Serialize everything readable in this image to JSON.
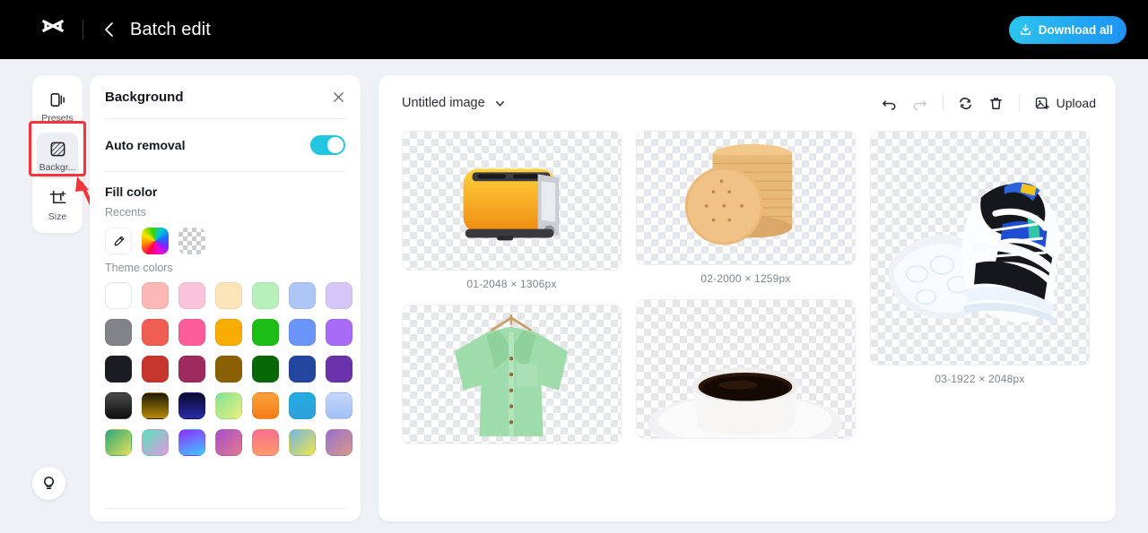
{
  "header": {
    "logo_icon": "capcut-logo-icon",
    "back_icon": "chevron-left-icon",
    "title": "Batch edit",
    "download_label": "Download all",
    "download_icon": "download-icon",
    "accent": "#22a7f0",
    "bar_bg": "#000000"
  },
  "sidebar": {
    "items": [
      {
        "label": "Presets",
        "icon": "presets-icon",
        "active": false
      },
      {
        "label": "Backgr...",
        "icon": "background-icon",
        "active": true
      },
      {
        "label": "Size",
        "icon": "crop-size-icon",
        "active": false
      }
    ],
    "tips_icon": "lightbulb-icon",
    "annotation_color": "#f4333a"
  },
  "panel": {
    "title": "Background",
    "close_icon": "close-icon",
    "auto_removal": {
      "label": "Auto removal",
      "state": "on",
      "toggle_color": "#22c6e0"
    },
    "fill_color": {
      "title": "Fill color",
      "recents_label": "Recents",
      "recents": [
        {
          "name": "eyedropper-swatch",
          "kind": "eyedropper"
        },
        {
          "name": "rainbow-picker-swatch",
          "kind": "rainbow"
        },
        {
          "name": "transparent-swatch",
          "kind": "checker"
        }
      ],
      "theme_label": "Theme colors",
      "theme_colors": [
        "#ffffff",
        "#fbb8b4",
        "#fbc3d9",
        "#fbe5b8",
        "#b8f0ba",
        "#adc6f6",
        "#d6c6f7",
        "#808286",
        "#ee5c52",
        "#fc5d9a",
        "#f8ac00",
        "#1cbf18",
        "#6a96fb",
        "#a濃"
      ],
      "theme_rows": [
        [
          "#ffffff",
          "#fbb8b4",
          "#fbc3d9",
          "#fbe5b8",
          "#b8f0ba",
          "#adc6f6",
          "#d6c6f7"
        ],
        [
          "#808286",
          "#ee5c52",
          "#fc5d9a",
          "#f8ac00",
          "#1cbf18",
          "#6a96fb",
          "#a86bf7"
        ],
        [
          "#1a1c22",
          "#c7362c",
          "#9f2a5e",
          "#8a6004",
          "#076806",
          "#23479e",
          "#6a32ab"
        ],
        [
          "linear-gradient(180deg,#4a4a4a,#0e0e0e)",
          "linear-gradient(180deg,#1e1a08,#b98a08)",
          "linear-gradient(180deg,#0a0a2e,#2a2aa8)",
          "linear-gradient(135deg,#7fe39a,#ecef7a)",
          "linear-gradient(180deg,#fba43a,#f47a18)",
          "linear-gradient(180deg,#22aee2,#2f9fd8)",
          "linear-gradient(180deg,#c8d6f7,#9fc0f8)"
        ],
        [
          "linear-gradient(135deg,#2aa87a,#e7e05a)",
          "linear-gradient(135deg,#56e0b8,#e09ae0)",
          "linear-gradient(160deg,#8f2bff,#3ecbff)",
          "linear-gradient(135deg,#a84fd0,#e07a8a)",
          "linear-gradient(180deg,#fb6f8f,#fb9a6a)",
          "linear-gradient(135deg,#6fb6e8,#f2e44a)",
          "linear-gradient(135deg,#9a6fd0,#d79a86)"
        ]
      ]
    }
  },
  "canvas": {
    "doc_name": "Untitled image",
    "doc_caret_icon": "chevron-down-icon",
    "tools": [
      {
        "name": "undo-button",
        "icon": "undo-icon",
        "enabled": true
      },
      {
        "name": "redo-button",
        "icon": "redo-icon",
        "enabled": false
      },
      {
        "name": "replace-button",
        "icon": "refresh-icon",
        "enabled": true
      },
      {
        "name": "delete-button",
        "icon": "trash-icon",
        "enabled": true
      }
    ],
    "upload_label": "Upload",
    "upload_icon": "image-add-icon",
    "images": [
      {
        "caption": "01-2048 × 1306px",
        "subject": "yellow-toaster"
      },
      {
        "caption": "02-2000 × 1259px",
        "subject": "biscuit-stack"
      },
      {
        "caption": "03-1922 × 2048px",
        "subject": "sneakers-pair"
      },
      {
        "caption": "",
        "subject": "green-shirt"
      },
      {
        "caption": "",
        "subject": "coffee-cup"
      }
    ]
  }
}
